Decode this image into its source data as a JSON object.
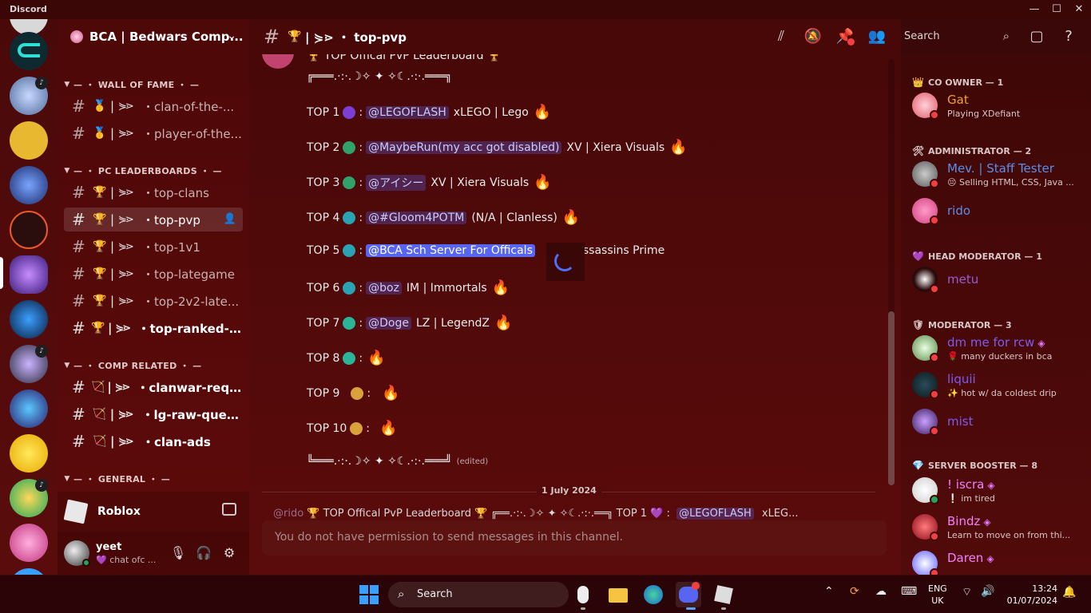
{
  "app": {
    "name": "Discord",
    "controls": [
      "—",
      "☐",
      "✕"
    ]
  },
  "guild": {
    "name": "BCA | Bedwars Comp...",
    "chevron": "⌄"
  },
  "categories": [
    {
      "label": "— ・ WALL OF FAME ・ —"
    },
    {
      "label": "— ・ PC LEADERBOARDS ・ —"
    },
    {
      "label": "— ・ COMP RELATED ・ —"
    },
    {
      "label": "— ・ GENERAL ・ —"
    }
  ],
  "channels": [
    {
      "emoji": "🥇",
      "name": "・clan-of-the-..."
    },
    {
      "emoji": "🥇",
      "name": "・player-of-the..."
    },
    {
      "emoji": "🏆",
      "name": "・top-clans"
    },
    {
      "emoji": "🏆",
      "name": "・top-pvp"
    },
    {
      "emoji": "🏆",
      "name": "・top-1v1"
    },
    {
      "emoji": "🏆",
      "name": "・top-lategame"
    },
    {
      "emoji": "🏆",
      "name": "・top-2v2-late..."
    },
    {
      "emoji": "🏆",
      "name": "・top-ranked-c..."
    },
    {
      "emoji": "🏹",
      "name": "・clanwar-requ..."
    },
    {
      "emoji": "🏹",
      "name": "・lg-raw-queue"
    },
    {
      "emoji": "🏹",
      "name": "・clan-ads"
    }
  ],
  "glyph": {
    "hash": "#",
    "sep": "|",
    "deco": "⋟⋗"
  },
  "activity": {
    "label": "Roblox"
  },
  "user": {
    "name": "yeet",
    "status": "💜 chat ofc ..."
  },
  "header": {
    "emoji": "🏆",
    "title": "| ⋟⋗ ・ top-pvp",
    "search_placeholder": "Search"
  },
  "message": {
    "title": "🏆 TOP Offical PvP Leaderboard 🏆",
    "border_top": "╔═══.·:·.☽✧  ✦  ✧☾.·:·.═══╗",
    "border_bottom": "╚═══.·:·.☽✧  ✦  ✧☾.·:·.═══╝",
    "edited": "(edited)",
    "entries": [
      {
        "rank": "TOP 1",
        "mention": "@LEGOFLASH",
        "text": "xLEGO | Lego",
        "medal": "#7b3fd6"
      },
      {
        "rank": "TOP 2",
        "mention": "@MaybeRun(my acc got disabled)",
        "text": "XV | Xiera Visuals",
        "medal": "#2fa36b"
      },
      {
        "rank": "TOP 3",
        "mention": "@アイシー",
        "text": "XV | Xiera Visuals",
        "medal": "#2fa36b"
      },
      {
        "rank": "TOP 4",
        "mention": "@#Gloom4POTM",
        "text": "(N/A | Clanless)",
        "medal": "#2aa4b5"
      },
      {
        "rank": "TOP 5",
        "mention": "@BCA Sch Server For Officals",
        "text": "ssassins Prime",
        "medal": "#2aa4b5"
      },
      {
        "rank": "TOP 6",
        "mention": "@boz",
        "text": "IM | Immortals",
        "medal": "#2aa4b5"
      },
      {
        "rank": "TOP 7",
        "mention": "@Doge",
        "text": "LZ | LegendZ",
        "medal": "#2ab59a"
      },
      {
        "rank": "TOP 8",
        "mention": "",
        "text": "",
        "medal": "#2ab59a"
      },
      {
        "rank": "TOP 9",
        "mention": "",
        "text": "",
        "medal": "#d9a23a"
      },
      {
        "rank": "TOP 10",
        "mention": "",
        "text": "",
        "medal": "#d9a23a"
      }
    ],
    "colon": ":",
    "flame": "🔥"
  },
  "date_divider": "1 July 2024",
  "reply_preview": {
    "user": "@rido",
    "text": "🏆 TOP Offical PvP Leaderboard 🏆  ╔══.·:·.☽✧  ✦  ✧☾.·:·.══╗  TOP 1 💜 :",
    "mention": "@LEGOFLASH",
    "tail": "xLEG..."
  },
  "composer": {
    "placeholder": "You do not have permission to send messages in this channel."
  },
  "roles": [
    {
      "icon": "👑",
      "label": "CO OWNER — 1"
    },
    {
      "icon": "🛠",
      "label": "ADMINISTRATOR — 2"
    },
    {
      "icon": "💜",
      "label": "HEAD MODERATOR — 1"
    },
    {
      "icon": "🛡",
      "label": "MODERATOR — 3"
    },
    {
      "icon": "💎",
      "label": "SERVER BOOSTER — 8"
    }
  ],
  "members": [
    {
      "name": "Gat",
      "sub": "Playing XDefiant",
      "color": "#f0a030"
    },
    {
      "name": "Mev. | Staff Tester",
      "sub": "😔 Selling HTML, CSS, Java ...",
      "color": "#5b8ee8"
    },
    {
      "name": "rido",
      "sub": "",
      "color": "#5b8ee8"
    },
    {
      "name": "metu",
      "sub": "",
      "color": "#9b59d6"
    },
    {
      "name": "dm me for rcw",
      "sub": "🌹 many duckers in bca",
      "color": "#7c5cf0"
    },
    {
      "name": "liquii",
      "sub": "✨ hot w/ da coldest drip",
      "color": "#7c5cf0"
    },
    {
      "name": "mist",
      "sub": "",
      "color": "#7c5cf0"
    },
    {
      "name": "! iscra",
      "sub": "❕ im tired",
      "color": "#f47fff"
    },
    {
      "name": "Bindz",
      "sub": "Learn to move on from thi...",
      "color": "#f47fff"
    },
    {
      "name": "Daren",
      "sub": "",
      "color": "#f47fff"
    }
  ],
  "taskbar": {
    "search_placeholder": "Search",
    "lang": "ENG",
    "region": "UK",
    "time": "13:24",
    "date": "01/07/2024"
  }
}
